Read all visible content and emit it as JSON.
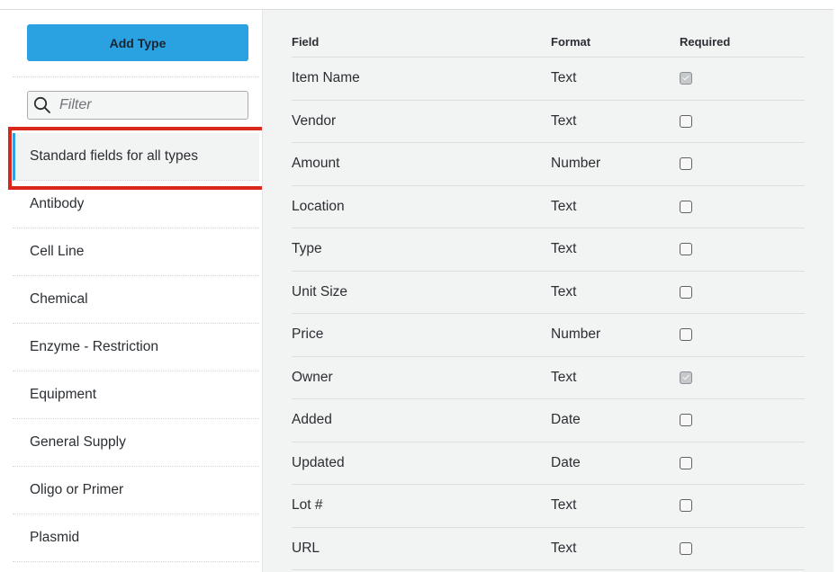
{
  "sidebar": {
    "add_type_label": "Add Type",
    "filter_placeholder": "Filter",
    "items": [
      {
        "label": "Standard fields for all types",
        "active": true
      },
      {
        "label": "Antibody"
      },
      {
        "label": "Cell Line"
      },
      {
        "label": "Chemical"
      },
      {
        "label": "Enzyme - Restriction"
      },
      {
        "label": "Equipment"
      },
      {
        "label": "General Supply"
      },
      {
        "label": "Oligo or Primer"
      },
      {
        "label": "Plasmid"
      }
    ]
  },
  "table": {
    "headers": {
      "field": "Field",
      "format": "Format",
      "required": "Required"
    },
    "rows": [
      {
        "field": "Item Name",
        "format": "Text",
        "required": true
      },
      {
        "field": "Vendor",
        "format": "Text",
        "required": false
      },
      {
        "field": "Amount",
        "format": "Number",
        "required": false
      },
      {
        "field": "Location",
        "format": "Text",
        "required": false
      },
      {
        "field": "Type",
        "format": "Text",
        "required": false
      },
      {
        "field": "Unit Size",
        "format": "Text",
        "required": false
      },
      {
        "field": "Price",
        "format": "Number",
        "required": false
      },
      {
        "field": "Owner",
        "format": "Text",
        "required": true
      },
      {
        "field": "Added",
        "format": "Date",
        "required": false
      },
      {
        "field": "Updated",
        "format": "Date",
        "required": false
      },
      {
        "field": "Lot #",
        "format": "Text",
        "required": false
      },
      {
        "field": "URL",
        "format": "Text",
        "required": false
      }
    ]
  },
  "colors": {
    "accent": "#2aa1e0",
    "highlight_border": "#d9271c",
    "panel_background": "#f2f3f3"
  },
  "icons": {
    "filter": "search-icon",
    "required_checked": "checkmark-icon"
  }
}
